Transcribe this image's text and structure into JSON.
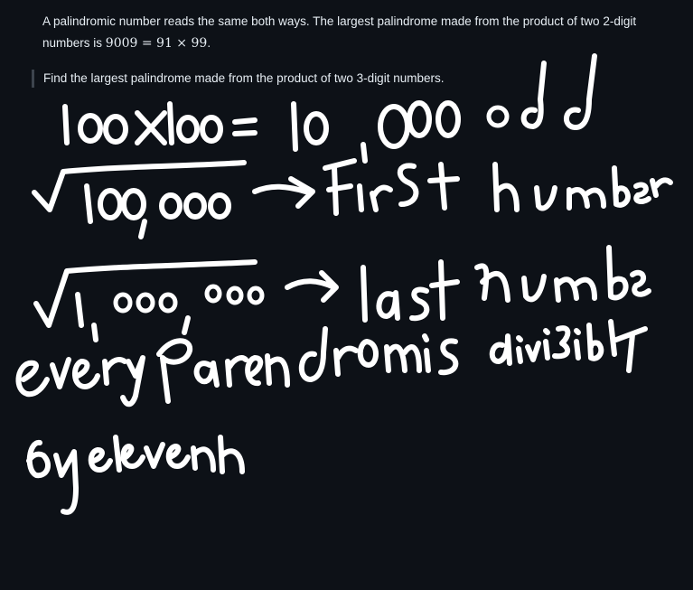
{
  "problem": {
    "text_before_math": "A palindromic number reads the same both ways. The largest palindrome made from the product of two 2-digit numbers is ",
    "math_expression": "9009 = 91 × 99",
    "text_after_math": "."
  },
  "task": {
    "text": "Find the largest palindrome made from the product of two 3-digit numbers."
  },
  "handwriting": {
    "line_1": "100 x 100 = 10,000 odd",
    "line_2": "√100,000 → First number",
    "line_3": "√1,000,000 → last number",
    "line_4": "every Palendromis divisible",
    "line_5": "by eleven"
  },
  "colors": {
    "background": "#0d1117",
    "text": "#e6edf3",
    "ink": "#ffffff",
    "quote_bar": "#3d444d"
  }
}
